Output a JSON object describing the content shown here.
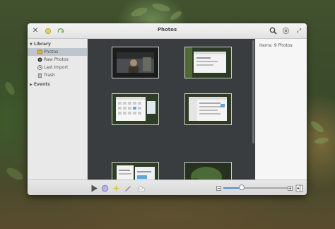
{
  "window": {
    "title": "Photos"
  },
  "sidebar": {
    "library_label": "Library",
    "items": [
      {
        "label": "Photos",
        "icon": "photos-icon",
        "selected": true
      },
      {
        "label": "Raw Photos",
        "icon": "raw-photos-icon",
        "selected": false
      },
      {
        "label": "Last Import",
        "icon": "clock-icon",
        "selected": false
      },
      {
        "label": "Trash",
        "icon": "trash-icon",
        "selected": false
      }
    ],
    "events_label": "Events"
  },
  "info": {
    "items_text": "Items:  9 Photos"
  },
  "toolbar": {
    "zoom_level": 0.28,
    "accent": "#4e8fd1"
  }
}
